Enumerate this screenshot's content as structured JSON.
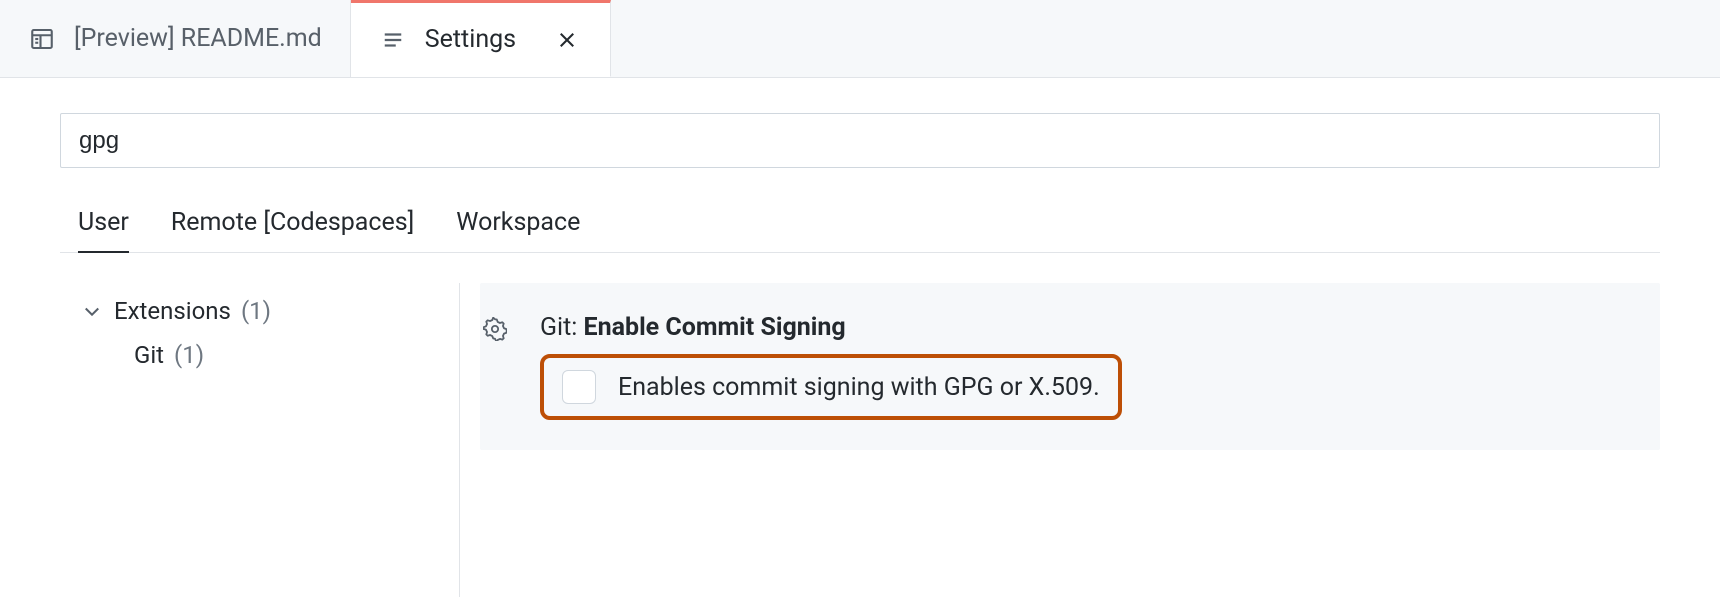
{
  "tabs": {
    "inactive_label": "[Preview] README.md",
    "active_label": "Settings"
  },
  "search": {
    "value": "gpg"
  },
  "scope": {
    "user": "User",
    "remote": "Remote [Codespaces]",
    "workspace": "Workspace"
  },
  "tree": {
    "extensions_label": "Extensions",
    "extensions_count": "(1)",
    "git_label": "Git",
    "git_count": "(1)"
  },
  "setting": {
    "ext": "Git: ",
    "name": "Enable Commit Signing",
    "desc": "Enables commit signing with GPG or X.509."
  }
}
